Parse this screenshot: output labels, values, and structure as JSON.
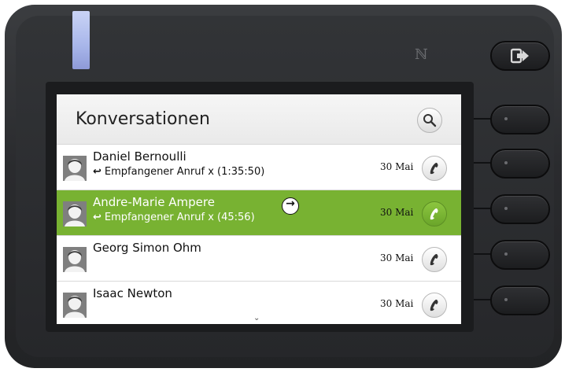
{
  "screen": {
    "title": "Konversationen",
    "scroll_hint": "⌄"
  },
  "conversations": [
    {
      "name": "Daniel Bernoulli",
      "call_icon": "↩",
      "detail": "Empfangener Anruf x (1:35:50)",
      "date": "30 Mai",
      "selected": false
    },
    {
      "name": "Andre-Marie Ampere",
      "call_icon": "↩",
      "detail": "Empfangener Anruf x (45:56)",
      "date": "30 Mai",
      "selected": true
    },
    {
      "name": "Georg Simon Ohm",
      "call_icon": "",
      "detail": "",
      "date": "30 Mai",
      "selected": false
    },
    {
      "name": "Isaac Newton",
      "call_icon": "",
      "detail": "",
      "date": "30 Mai",
      "selected": false
    }
  ],
  "icons": {
    "search": "search-icon",
    "avatar": "avatar-icon",
    "phone": "phone-icon",
    "details_arrow": "→",
    "exit": "exit-icon",
    "nfc": "ℕ"
  },
  "colors": {
    "selected_row": "#78b232",
    "led": "#a8b6ea",
    "housing": "#2a2b2e"
  }
}
